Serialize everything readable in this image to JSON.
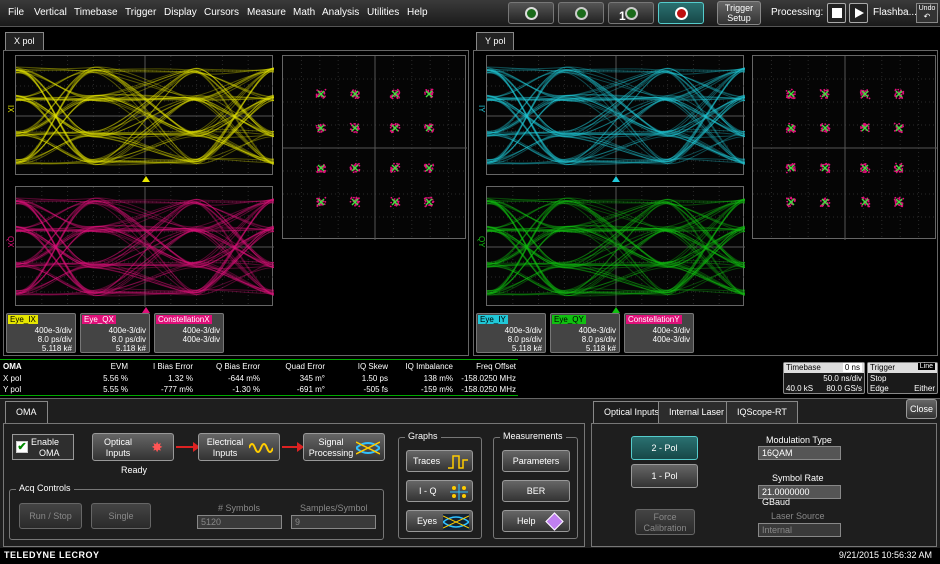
{
  "menu": [
    "File",
    "Vertical",
    "Timebase",
    "Trigger",
    "Display",
    "Cursors",
    "Measure",
    "Math",
    "Analysis",
    "Utilities",
    "Help"
  ],
  "toolbar": {
    "trigger_setup": [
      "Trigger",
      "Setup"
    ],
    "processing_label": "Processing:",
    "flashback_label": "Flashba...",
    "undo_label": "Undo",
    "btn3_badge": "1"
  },
  "x_pol": {
    "tab": "X pol",
    "eye_i_label": "IX",
    "eye_q_label": "QX",
    "descriptors": [
      {
        "name": "Eye_IX",
        "color": "#e6e600",
        "lines": [
          "400e-3/div",
          "8.0 ps/div",
          "5.118 k#"
        ]
      },
      {
        "name": "Eye_QX",
        "color": "#e0107a",
        "lines": [
          "400e-3/div",
          "8.0 ps/div",
          "5.118 k#"
        ]
      },
      {
        "name": "ConstellationX",
        "color": "#e0107a",
        "lines": [
          "400e-3/div",
          "400e-3/div"
        ]
      }
    ]
  },
  "y_pol": {
    "tab": "Y pol",
    "eye_i_label": "IY",
    "eye_q_label": "QY",
    "descriptors": [
      {
        "name": "Eye_IY",
        "color": "#20c8d8",
        "lines": [
          "400e-3/div",
          "8.0 ps/div",
          "5.118 k#"
        ]
      },
      {
        "name": "Eye_QY",
        "color": "#10c010",
        "lines": [
          "400e-3/div",
          "8.0 ps/div",
          "5.118 k#"
        ]
      },
      {
        "name": "ConstellationY",
        "color": "#e0107a",
        "lines": [
          "400e-3/div",
          "400e-3/div"
        ]
      }
    ]
  },
  "oma_table": {
    "headers": [
      "OMA",
      "EVM",
      "I Bias Error",
      "Q Bias Error",
      "Quad Error",
      "IQ Skew",
      "IQ Imbalance",
      "Freq Offset"
    ],
    "rows": [
      [
        "X pol",
        "5.56 %",
        "1.32 %",
        "-644 m%",
        "345 m°",
        "1.50 ps",
        "138 m%",
        "-158.0250 MHz"
      ],
      [
        "Y pol",
        "5.55 %",
        "-777 m%",
        "-1.30 %",
        "-691 m°",
        "-505 fs",
        "-159 m%",
        "-158.0250 MHz"
      ]
    ]
  },
  "timebase": {
    "title": "Timebase",
    "offset": "0 ns",
    "rows": [
      [
        "",
        "50.0 ns/div"
      ],
      [
        "40.0 kS",
        "80.0 GS/s"
      ]
    ]
  },
  "trigger": {
    "title": "Trigger",
    "mode_badge": "Line",
    "rows": [
      [
        "Stop",
        ""
      ],
      [
        "Edge",
        "Either"
      ]
    ]
  },
  "dialog": {
    "tab_oma": "OMA",
    "enable_label": [
      "Enable",
      "OMA"
    ],
    "optical_inputs": [
      "Optical",
      "Inputs"
    ],
    "ready": "Ready",
    "electrical_inputs": [
      "Electrical",
      "Inputs"
    ],
    "signal_processing": [
      "Signal",
      "Processing"
    ],
    "acq_controls": "Acq Controls",
    "run_stop": "Run / Stop",
    "single": "Single",
    "symbols_label": "# Symbols",
    "symbols_value": "5120",
    "samples_label": "Samples/Symbol",
    "samples_value": "9",
    "graphs_title": "Graphs",
    "traces": "Traces",
    "iq": "I - Q",
    "eyes": "Eyes",
    "measurements_title": "Measurements",
    "parameters": "Parameters",
    "ber": "BER",
    "help": "Help",
    "right_tabs": [
      "Optical Inputs",
      "Internal Laser",
      "IQScope-RT"
    ],
    "close": "Close",
    "pol2": "2 - Pol",
    "pol1": "1 - Pol",
    "force_cal": [
      "Force",
      "Calibration"
    ],
    "mod_type_label": "Modulation Type",
    "mod_type_value": "16QAM",
    "symbol_rate_label": "Symbol Rate",
    "symbol_rate_value": "21.0000000 GBaud",
    "laser_source_label": "Laser Source",
    "laser_source_value": "Internal"
  },
  "status": {
    "brand": "TELEDYNE LECROY",
    "datetime": "9/21/2015 10:56:32 AM"
  },
  "colors": {
    "yellow": "#e6e600",
    "magenta": "#e0107a",
    "cyan": "#20c8d8",
    "green": "#10c010"
  }
}
